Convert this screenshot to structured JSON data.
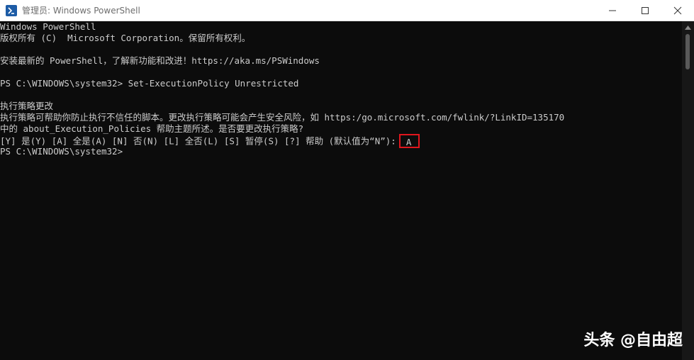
{
  "window": {
    "title": "管理员: Windows PowerShell"
  },
  "console": {
    "lines": [
      "Windows PowerShell",
      "版权所有 (C)  Microsoft Corporation。保留所有权利。",
      "",
      "安装最新的 PowerShell，了解新功能和改进！https://aka.ms/PSWindows",
      "",
      "PS C:\\WINDOWS\\system32> Set-ExecutionPolicy Unrestricted",
      "",
      "执行策略更改",
      "执行策略可帮助你防止执行不信任的脚本。更改执行策略可能会产生安全风险，如 https:/go.microsoft.com/fwlink/?LinkID=135170",
      "中的 about_Execution_Policies 帮助主题所述。是否要更改执行策略?",
      "",
      "PS C:\\WINDOWS\\system32>"
    ],
    "choice_prompt": "[Y] 是(Y)  [A] 全是(A)  [N] 否(N)  [L] 全否(L)  [S] 暂停(S)  [?] 帮助 (默认值为“N”):",
    "choice_answer": "A"
  },
  "watermark": {
    "text": "头条 @自由超"
  },
  "colors": {
    "console_bg": "#0c0c0c",
    "console_fg": "#cccccc",
    "highlight_border": "#e0161d"
  }
}
